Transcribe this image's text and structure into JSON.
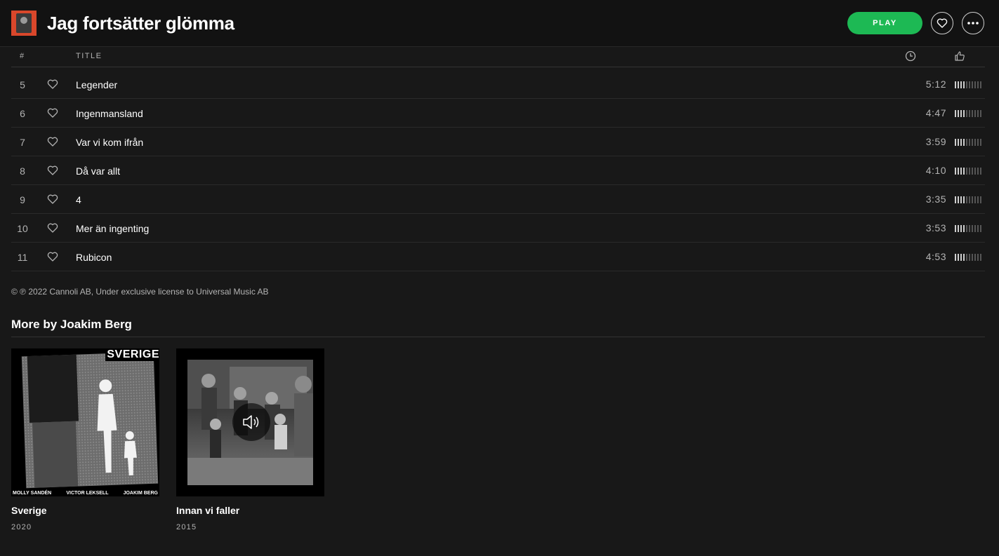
{
  "header": {
    "title": "Jag fortsätter glömma",
    "play_label": "PLAY"
  },
  "columns": {
    "number": "#",
    "title": "TITLE"
  },
  "tracks": [
    {
      "number": "5",
      "name": "Legender",
      "duration": "5:12",
      "popularity": 4
    },
    {
      "number": "6",
      "name": "Ingenmansland",
      "duration": "4:47",
      "popularity": 4
    },
    {
      "number": "7",
      "name": "Var vi kom ifrån",
      "duration": "3:59",
      "popularity": 4
    },
    {
      "number": "8",
      "name": "Då var allt",
      "duration": "4:10",
      "popularity": 4
    },
    {
      "number": "9",
      "name": "4",
      "duration": "3:35",
      "popularity": 4
    },
    {
      "number": "10",
      "name": "Mer än ingenting",
      "duration": "3:53",
      "popularity": 4
    },
    {
      "number": "11",
      "name": "Rubicon",
      "duration": "4:53",
      "popularity": 4
    }
  ],
  "copyright": "© ℗ 2022 Cannoli AB, Under exclusive license to Universal Music AB",
  "more_by": {
    "heading": "More by Joakim Berg",
    "albums": [
      {
        "title": "Sverige",
        "year": "2020",
        "cover_text": "SVERIGE",
        "cover_credits": [
          "MOLLY SANDÉN",
          "VICTOR LEKSELL",
          "JOAKIM BERG"
        ]
      },
      {
        "title": "Innan vi faller",
        "year": "2015"
      }
    ]
  },
  "colors": {
    "accent": "#1db954",
    "background": "#181818",
    "topbar": "#121212",
    "album_thumb": "#d9472b"
  },
  "icons": {
    "like_album": "heart-icon",
    "more": "more-icon",
    "duration": "clock-icon",
    "popularity": "thumbs-up-icon",
    "track_like": "heart-icon",
    "playing": "speaker-icon"
  }
}
